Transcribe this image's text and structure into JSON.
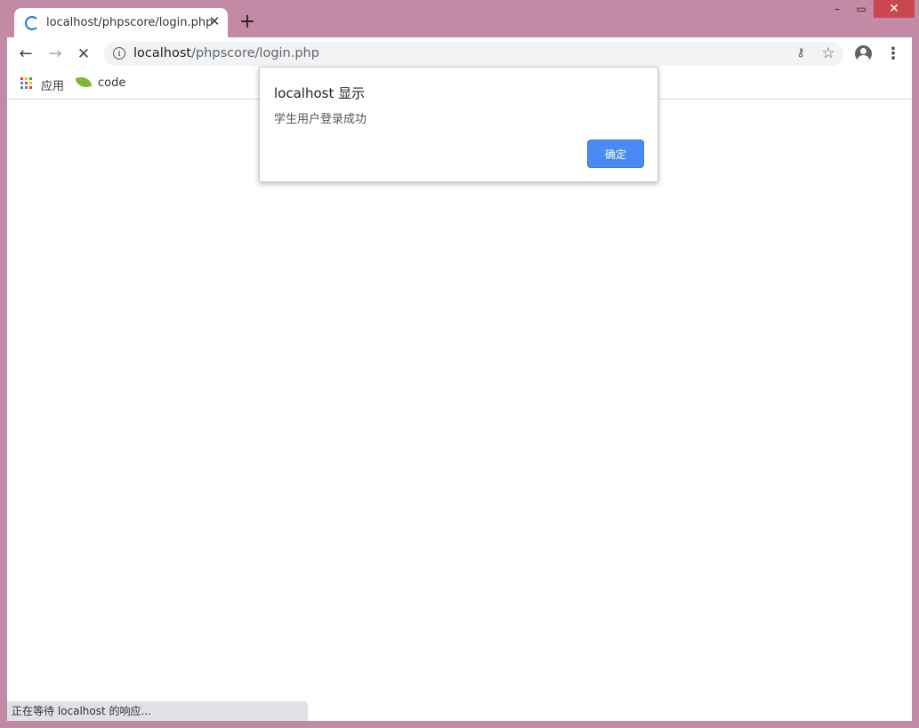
{
  "tab": {
    "title": "localhost/phpscore/login.php",
    "close": "✕"
  },
  "new_tab": "+",
  "window_controls": {
    "minimize": "–",
    "maximize": "▭",
    "close": "✕"
  },
  "toolbar": {
    "back": "←",
    "forward": "→",
    "stop": "✕",
    "url_host": "localhost",
    "url_path": "/phpscore/login.php",
    "info": "i",
    "key": "⚷",
    "star": "☆",
    "menu": "⋮"
  },
  "bookmarks": {
    "apps_label": "应用",
    "code_label": "code",
    "apps_colors": [
      "#ea4335",
      "#fbbc05",
      "#34a853",
      "#4285f4",
      "#ea4335",
      "#fbbc05",
      "#34a853",
      "#4285f4",
      "#ea4335"
    ]
  },
  "dialog": {
    "title": "localhost 显示",
    "message": "学生用户登录成功",
    "ok_label": "确定"
  },
  "status": {
    "text": "正在等待 localhost 的响应..."
  },
  "colors": {
    "frame": "#c38aa6",
    "accent": "#4a8af4",
    "close_button": "#c9484f"
  }
}
